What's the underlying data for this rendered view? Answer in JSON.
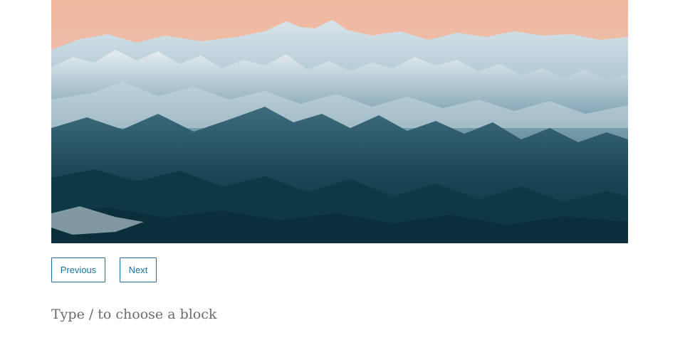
{
  "slideshow": {
    "image_alt": "Snow-covered mountain range at sunset",
    "next_icon": "chevron-right-icon"
  },
  "nav": {
    "previous_label": "Previous",
    "next_label": "Next"
  },
  "block_appender": {
    "placeholder": "Type / to choose a block"
  },
  "colors": {
    "button_border": "#1e72a0",
    "button_text": "#1e72a0",
    "sky_top": "#f1b89f",
    "mountain_dark": "#0f3a48",
    "snow": "#dfe9ee"
  }
}
